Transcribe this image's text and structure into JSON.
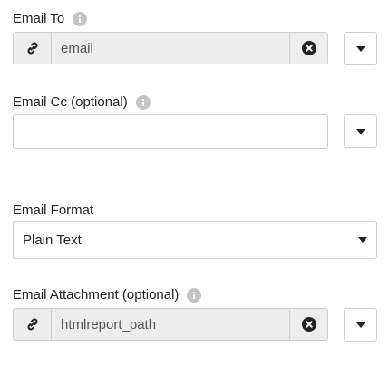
{
  "email_to": {
    "label": "Email To",
    "value": "email",
    "icons": {
      "info": "info-icon",
      "link": "link-icon",
      "clear": "clear-icon",
      "dropdown": "chevron-down-icon"
    }
  },
  "email_cc": {
    "label": "Email Cc (optional)",
    "value": "",
    "icons": {
      "info": "info-icon",
      "dropdown": "chevron-down-icon"
    }
  },
  "email_format": {
    "label": "Email Format",
    "selected": "Plain Text",
    "icons": {
      "dropdown": "chevron-down-icon"
    }
  },
  "email_attachment": {
    "label": "Email Attachment (optional)",
    "value": "htmlreport_path",
    "icons": {
      "info": "info-icon",
      "link": "link-icon",
      "clear": "clear-icon",
      "dropdown": "chevron-down-icon"
    }
  },
  "colors": {
    "field_filled_bg": "#ededed",
    "border": "#cfcfcf",
    "info_icon": "#c4c4c4",
    "text": "#222222"
  }
}
